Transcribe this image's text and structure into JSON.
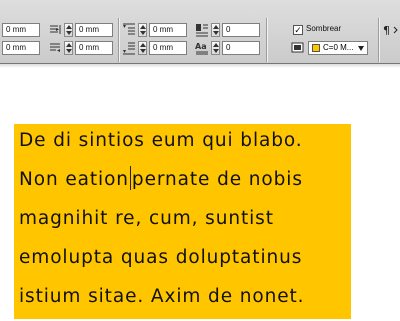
{
  "control_panel": {
    "left_indent": "0 mm",
    "right_indent": "0 mm",
    "first_line_indent": "0 mm",
    "last_line_right_indent": "0 mm",
    "space_before": "0 mm",
    "space_after": "0 mm",
    "drop_cap_lines": "0",
    "drop_cap_chars": "0",
    "shading_label": "Sombrear",
    "shading_checked": true,
    "shading_color_name": "C=0 M...",
    "shading_color_hex": "#FFC600"
  },
  "document": {
    "paragraph_lines": [
      "De di sintios eum qui blabo.",
      "Non eation",
      "pernate de nobis",
      "magnihit re, cum, suntist",
      "emolupta quas doluptatinus",
      "istium sitae. Axim de nonet."
    ]
  }
}
